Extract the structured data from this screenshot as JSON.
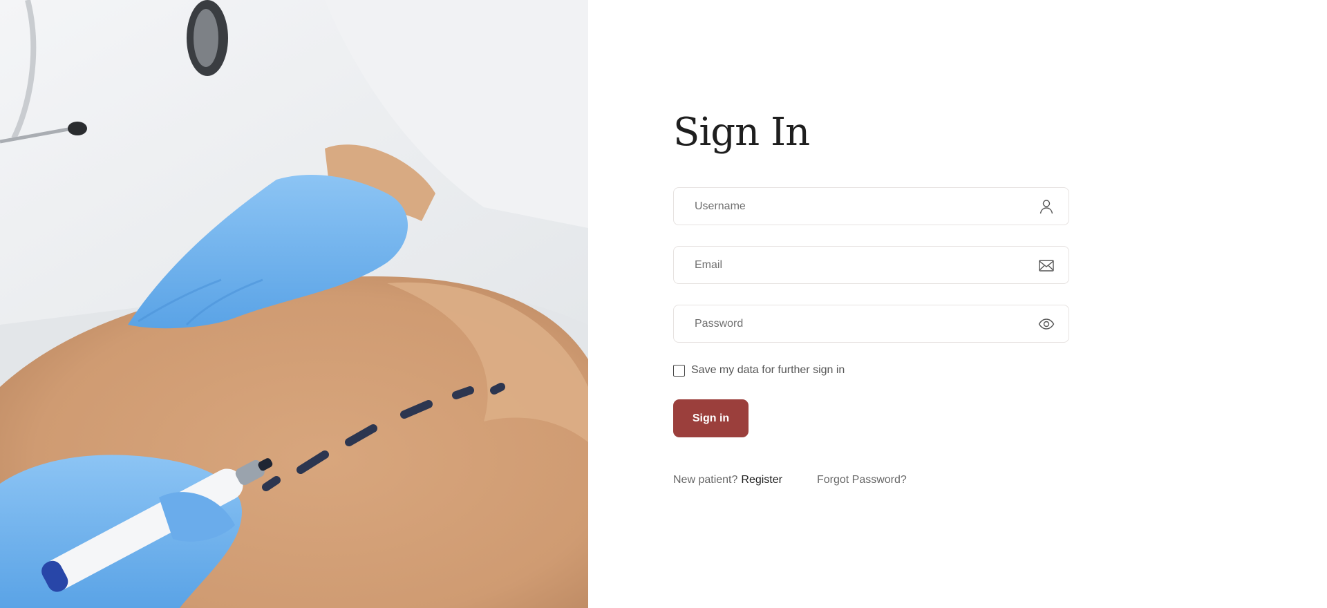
{
  "form": {
    "title": "Sign In",
    "username_placeholder": "Username",
    "email_placeholder": "Email",
    "password_placeholder": "Password",
    "remember_label": "Save my data for further sign in",
    "signin_label": "Sign in"
  },
  "footer": {
    "new_patient": "New patient?",
    "register": "Register",
    "forgot": "Forgot Password?"
  },
  "icons": {
    "username": "user-icon",
    "email": "envelope-icon",
    "password": "eye-icon"
  },
  "colors": {
    "accent": "#9b3f3c",
    "glove": "#6fb2ee",
    "skin": "#d9ab83"
  }
}
